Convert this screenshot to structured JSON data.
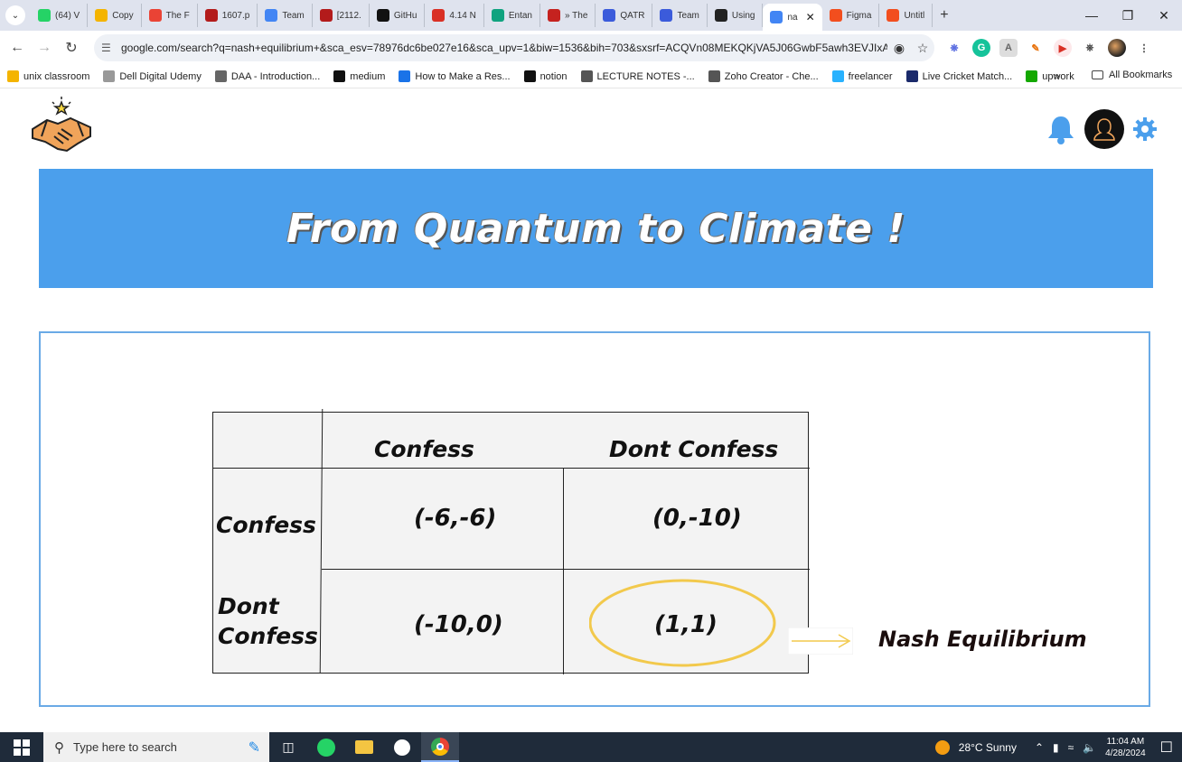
{
  "browser": {
    "tabs": [
      {
        "label": "(64) V",
        "color": "#25d366"
      },
      {
        "label": "Copy",
        "color": "#f4b400"
      },
      {
        "label": "The F",
        "color": "#ea4335"
      },
      {
        "label": "1607.p",
        "color": "#b31b1b"
      },
      {
        "label": "Team",
        "color": "#4285f4"
      },
      {
        "label": "[2112.",
        "color": "#b31b1b"
      },
      {
        "label": "GitHu",
        "color": "#111111"
      },
      {
        "label": "4.14 N",
        "color": "#d93025"
      },
      {
        "label": "Entan",
        "color": "#10a37f"
      },
      {
        "label": "» The",
        "color": "#c5221f"
      },
      {
        "label": "QATR",
        "color": "#3b5bdb"
      },
      {
        "label": "Team",
        "color": "#3b5bdb"
      },
      {
        "label": "Using",
        "color": "#222222"
      }
    ],
    "active_tab": {
      "label": "na",
      "color": "#4285f4"
    },
    "tabs_after": [
      {
        "label": "Figma",
        "color": "#f24e1e"
      },
      {
        "label": "Untitl",
        "color": "#f24e1e"
      }
    ],
    "url": "google.com/search?q=nash+equilibrium+&sca_esv=78976dc6be027e16&sca_upv=1&biw=1536&bih=703&sxsrf=ACQVn08MEKQKjVA5J06GwbF5awh3EVJIxA...",
    "bookmarks": [
      {
        "label": "unix classroom",
        "color": "#f4b400"
      },
      {
        "label": "Dell Digital Udemy",
        "color": "#999999"
      },
      {
        "label": "DAA - Introduction...",
        "color": "#666666"
      },
      {
        "label": "medium",
        "color": "#111111"
      },
      {
        "label": "How to Make a Res...",
        "color": "#1a73e8"
      },
      {
        "label": "notion",
        "color": "#111111"
      },
      {
        "label": "LECTURE NOTES -...",
        "color": "#555555"
      },
      {
        "label": "Zoho Creator - Che...",
        "color": "#555555"
      },
      {
        "label": "freelancer",
        "color": "#29b2fe"
      },
      {
        "label": "Live Cricket Match...",
        "color": "#1b2a6b"
      },
      {
        "label": "upwork",
        "color": "#14a800"
      }
    ],
    "bookmarks_more": "»",
    "all_bookmarks": "All Bookmarks"
  },
  "page": {
    "banner_title": "From Quantum to Climate !",
    "accent_color": "#4b9fec",
    "matrix": {
      "col_headers": [
        "Confess",
        "Dont Confess"
      ],
      "row_headers": [
        "Confess",
        "Dont\nConfess"
      ],
      "payoffs": [
        [
          "(-6,-6)",
          "(0,-10)"
        ],
        [
          "(-10,0)",
          "(1,1)"
        ]
      ],
      "highlight_color": "#f2c94c"
    },
    "nash_label": "Nash Equilibrium"
  },
  "taskbar": {
    "search_placeholder": "Type here to search",
    "weather": "28°C  Sunny",
    "time": "11:04 AM",
    "date": "4/28/2024"
  }
}
